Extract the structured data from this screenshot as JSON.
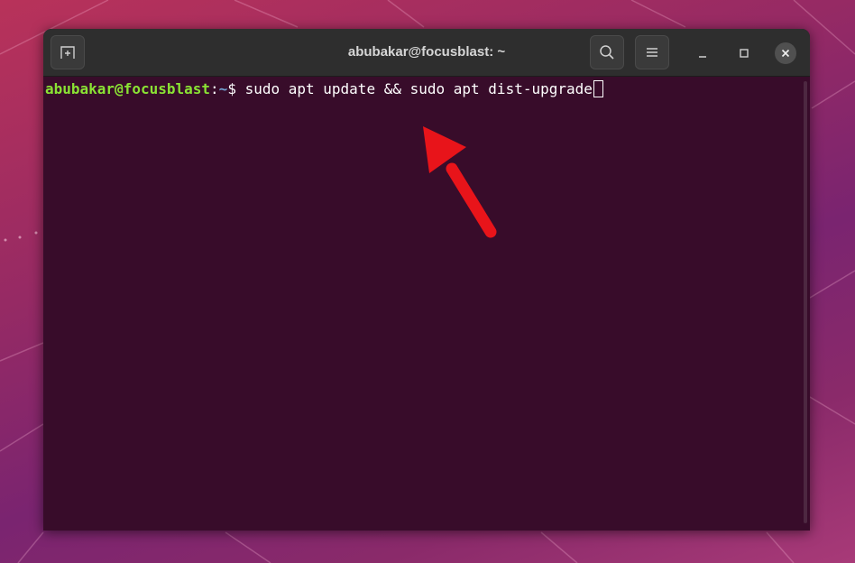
{
  "window": {
    "title": "abubakar@focusblast: ~"
  },
  "titlebar": {
    "new_tab_icon": "new-tab-icon",
    "search_icon": "search-icon",
    "menu_icon": "hamburger-menu-icon",
    "minimize_icon": "minimize-icon",
    "maximize_icon": "maximize-icon",
    "close_icon": "close-icon"
  },
  "terminal": {
    "prompt_user": "abubakar@focusblast",
    "prompt_sep": ":",
    "prompt_path": "~",
    "prompt_symbol": "$ ",
    "command": "sudo apt update && sudo apt dist-upgrade"
  },
  "colors": {
    "terminal_bg": "#380c2a",
    "prompt_user": "#8ae234",
    "prompt_path": "#729fcf",
    "annotation_arrow": "#e8141a"
  }
}
